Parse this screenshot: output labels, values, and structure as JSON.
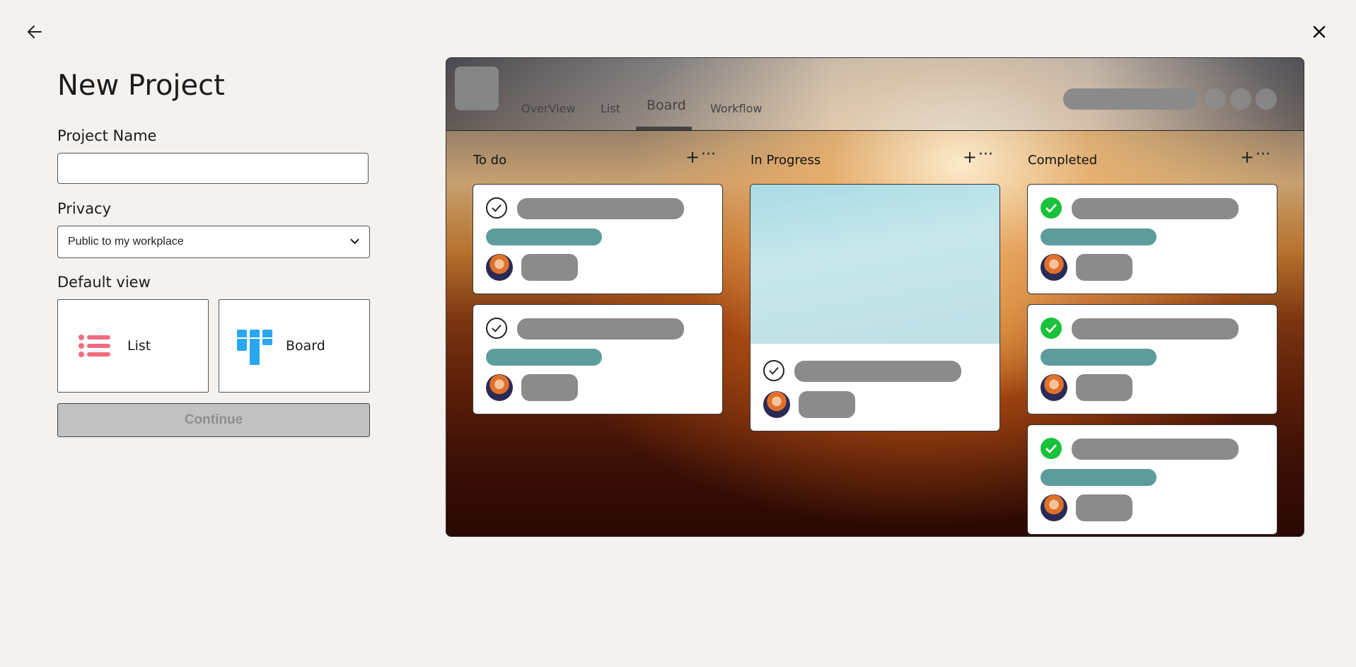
{
  "window": {
    "back_icon": "arrow-left-icon",
    "close_icon": "close-icon"
  },
  "form": {
    "title": "New Project",
    "project_name_label": "Project Name",
    "project_name_value": "",
    "privacy_label": "Privacy",
    "privacy_selected": "Public to my workplace",
    "default_view_label": "Default view",
    "views": [
      {
        "label": "List",
        "icon": "list-icon",
        "color": "#f06c7d"
      },
      {
        "label": "Board",
        "icon": "board-icon",
        "color": "#2aa7f0"
      }
    ],
    "continue_label": "Continue"
  },
  "preview": {
    "tabs": [
      "OverView",
      "List",
      "Board",
      "Workflow"
    ],
    "active_tab": "Board",
    "columns": [
      {
        "title": "To do",
        "add": "+",
        "more": "···"
      },
      {
        "title": "In Progress",
        "add": "+",
        "more": "···"
      },
      {
        "title": "Completed",
        "add": "+",
        "more": "···"
      }
    ],
    "colors": {
      "completed_check": "#19c23a",
      "tag": "#5e9c9c",
      "placeholder": "#8b8b8b"
    }
  }
}
